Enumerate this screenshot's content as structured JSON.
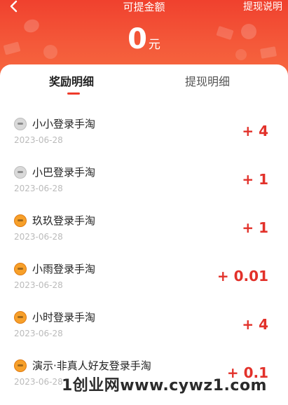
{
  "header": {
    "title": "可提金额",
    "help_label": "提现说明",
    "amount": "0",
    "unit": "元"
  },
  "tabs": [
    {
      "label": "奖励明细"
    },
    {
      "label": "提现明细"
    }
  ],
  "records": [
    {
      "name": "小小登录手淘",
      "date": "2023-06-28",
      "value": "+ 4",
      "avatar": "gray"
    },
    {
      "name": "小巴登录手淘",
      "date": "2023-06-28",
      "value": "+ 1",
      "avatar": "gray"
    },
    {
      "name": "玖玖登录手淘",
      "date": "2023-06-28",
      "value": "+ 1",
      "avatar": "orange"
    },
    {
      "name": "小雨登录手淘",
      "date": "2023-06-28",
      "value": "+ 0.01",
      "avatar": "orange"
    },
    {
      "name": "小时登录手淘",
      "date": "2023-06-28",
      "value": "+ 4",
      "avatar": "orange"
    },
    {
      "name": "演示·非真人好友登录手淘",
      "date": "2023-06-28",
      "value": "+ 0.1",
      "avatar": "orange"
    }
  ],
  "watermark": "1创业网www.cywz1.com"
}
